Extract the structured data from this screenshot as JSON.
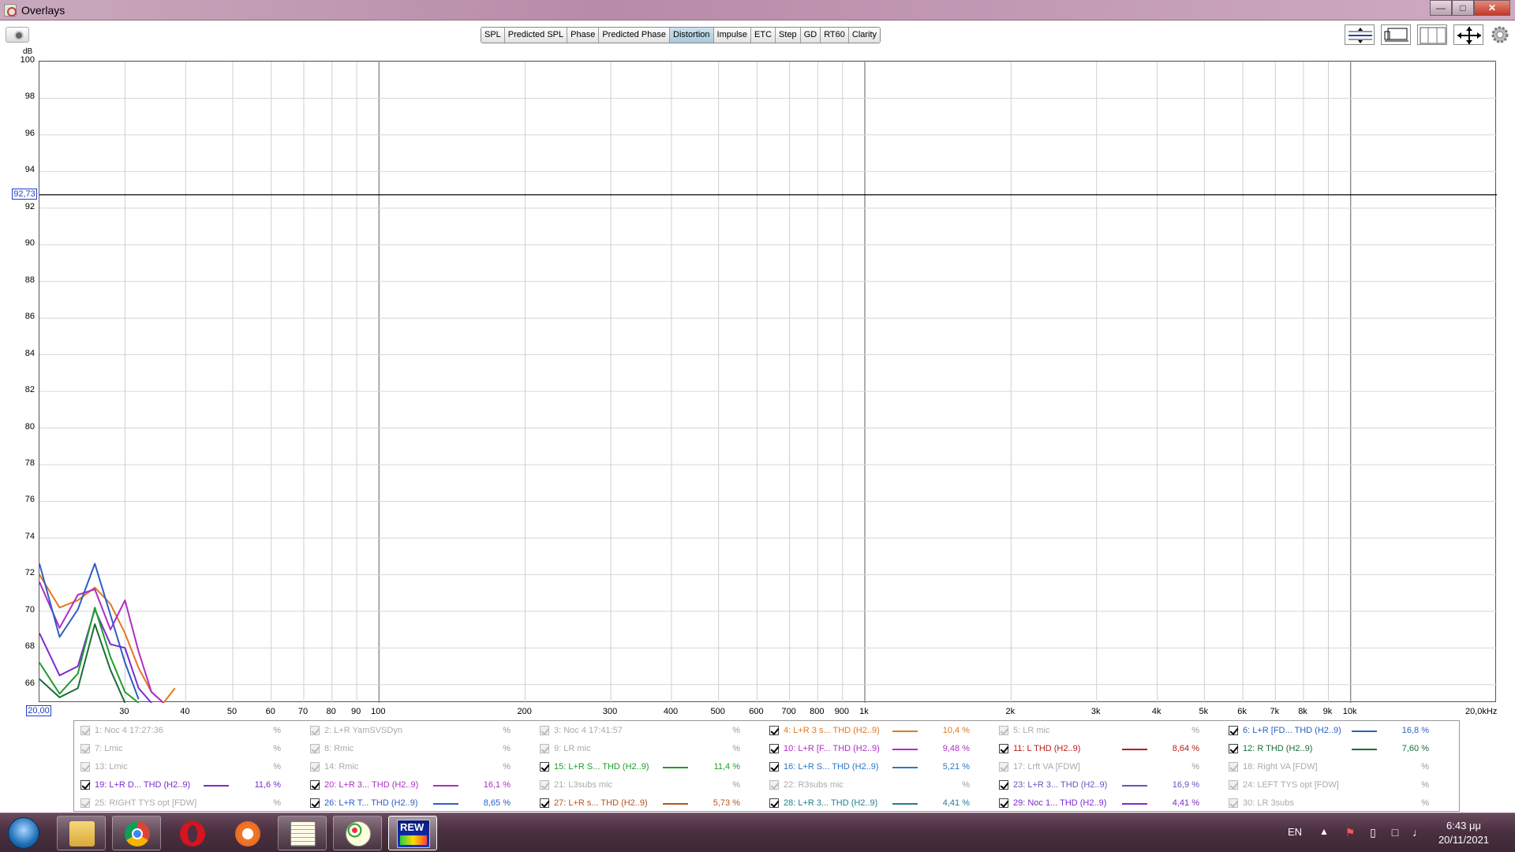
{
  "window": {
    "title": "Overlays"
  },
  "toolbar": {
    "tabs": [
      "SPL",
      "Predicted SPL",
      "Phase",
      "Predicted Phase",
      "Distortion",
      "Impulse",
      "ETC",
      "Step",
      "GD",
      "RT60",
      "Clarity"
    ],
    "active_tab": "Distortion"
  },
  "graph": {
    "y_unit": "dB",
    "y_ticks": [
      "100",
      "98",
      "96",
      "94",
      "92",
      "90",
      "88",
      "86",
      "84",
      "82",
      "80",
      "78",
      "76",
      "74",
      "72",
      "70",
      "68",
      "66"
    ],
    "x_ticks": [
      "30",
      "40",
      "50",
      "60",
      "70",
      "80",
      "90",
      "100",
      "200",
      "300",
      "400",
      "500",
      "600",
      "700",
      "800",
      "900",
      "1k",
      "2k",
      "3k",
      "4k",
      "5k",
      "6k",
      "7k",
      "8k",
      "9k",
      "10k"
    ],
    "x_end_label": "20,0kHz",
    "cursor_y": "92,73",
    "cursor_x": "20,00"
  },
  "chart_data": {
    "type": "line",
    "title": "",
    "xlabel": "",
    "ylabel": "dB",
    "x_scale": "log",
    "xlim": [
      20,
      20000
    ],
    "ylim": [
      65,
      100
    ],
    "grid": true,
    "cursor": {
      "x": 20.0,
      "y": 92.73
    },
    "series": [
      {
        "name": "4: L+R 3 s... THD (H2..9)",
        "color": "#e07a1f",
        "x": [
          20,
          22,
          24,
          26,
          28,
          30,
          32,
          34,
          36,
          38
        ],
        "y": [
          72.0,
          70.2,
          70.6,
          71.3,
          70.4,
          68.8,
          66.9,
          65.6,
          65.0,
          65.8
        ]
      },
      {
        "name": "10: L+R [F... THD (H2..9)",
        "color": "#b02cc7",
        "x": [
          20,
          22,
          24,
          26,
          28,
          30,
          32,
          34,
          36
        ],
        "y": [
          71.6,
          69.1,
          70.9,
          71.2,
          69.0,
          70.6,
          67.8,
          65.6,
          65.0
        ]
      },
      {
        "name": "6: L+R [FD... THD (H2..9)",
        "color": "#2b5fc6",
        "x": [
          20,
          22,
          24,
          26,
          28,
          30,
          32
        ],
        "y": [
          72.6,
          68.6,
          70.1,
          72.6,
          69.8,
          67.2,
          65.2
        ]
      },
      {
        "name": "19: L+R D... THD (H2..9)",
        "color": "#7a2ccf",
        "x": [
          20,
          22,
          24,
          26,
          28,
          30,
          32,
          34
        ],
        "y": [
          68.8,
          66.5,
          67.0,
          70.1,
          68.2,
          68.0,
          65.8,
          65.0
        ]
      },
      {
        "name": "15: L+R S... THD (H2..9)",
        "color": "#1e9e2a",
        "x": [
          20,
          22,
          24,
          26,
          28,
          30,
          32
        ],
        "y": [
          67.2,
          65.5,
          66.6,
          70.2,
          67.5,
          65.6,
          65.0
        ]
      },
      {
        "name": "12: R THD (H2..9)",
        "color": "#1c6b3a",
        "x": [
          20,
          22,
          24,
          26,
          28,
          30
        ],
        "y": [
          66.3,
          65.3,
          65.8,
          69.3,
          66.8,
          65.0
        ]
      }
    ]
  },
  "legend": [
    {
      "num": "1",
      "name": "1: Noc 4 17:27:36",
      "checked": false,
      "color": "",
      "value": "%"
    },
    {
      "num": "2",
      "name": "2: L+R YamSVSDyn",
      "checked": false,
      "color": "",
      "value": "%"
    },
    {
      "num": "3",
      "name": "3: Noc 4 17:41:57",
      "checked": false,
      "color": "",
      "value": "%"
    },
    {
      "num": "4",
      "name": "4: L+R 3 s... THD (H2..9)",
      "checked": true,
      "color": "#e07a1f",
      "value": "10,4 %"
    },
    {
      "num": "5",
      "name": "5: LR mic",
      "checked": false,
      "color": "",
      "value": "%"
    },
    {
      "num": "6",
      "name": "6: L+R [FD... THD (H2..9)",
      "checked": true,
      "color": "#2b5fc6",
      "value": "16,8 %"
    },
    {
      "num": "7",
      "name": "7: Lmic",
      "checked": false,
      "color": "",
      "value": "%"
    },
    {
      "num": "8",
      "name": "8: Rmic",
      "checked": false,
      "color": "",
      "value": "%"
    },
    {
      "num": "9",
      "name": "9: LR mic",
      "checked": false,
      "color": "",
      "value": "%"
    },
    {
      "num": "10",
      "name": "10: L+R [F... THD (H2..9)",
      "checked": true,
      "color": "#b02cc7",
      "value": "9,48 %"
    },
    {
      "num": "11",
      "name": "11: L THD (H2..9)",
      "checked": true,
      "color": "#b51e1e",
      "value": "8,64 %"
    },
    {
      "num": "12",
      "name": "12: R THD (H2..9)",
      "checked": true,
      "color": "#1c6b3a",
      "value": "7,60 %"
    },
    {
      "num": "13",
      "name": "13: Lmic",
      "checked": false,
      "color": "",
      "value": "%"
    },
    {
      "num": "14",
      "name": "14: Rmic",
      "checked": false,
      "color": "",
      "value": "%"
    },
    {
      "num": "15",
      "name": "15: L+R S... THD (H2..9)",
      "checked": true,
      "color": "#1e9e2a",
      "value": "11,4 %"
    },
    {
      "num": "16",
      "name": "16: L+R S... THD (H2..9)",
      "checked": true,
      "color": "#2a78c8",
      "value": "5,21 %"
    },
    {
      "num": "17",
      "name": "17: Lrft VA [FDW]",
      "checked": false,
      "color": "",
      "value": "%"
    },
    {
      "num": "18",
      "name": "18: Right VA [FDW]",
      "checked": false,
      "color": "",
      "value": "%"
    },
    {
      "num": "19",
      "name": "19: L+R D... THD (H2..9)",
      "checked": true,
      "color": "#7a2ccf",
      "value": "11,6 %"
    },
    {
      "num": "20",
      "name": "20: L+R 3... THD (H2..9)",
      "checked": true,
      "color": "#b02cc7",
      "value": "16,1 %"
    },
    {
      "num": "21",
      "name": "21: L3subs mic",
      "checked": false,
      "color": "",
      "value": "%"
    },
    {
      "num": "22",
      "name": "22: R3subs mic",
      "checked": false,
      "color": "",
      "value": "%"
    },
    {
      "num": "23",
      "name": "23: L+R 3... THD (H2..9)",
      "checked": true,
      "color": "#6f4fc6",
      "value": "16,9 %"
    },
    {
      "num": "24",
      "name": "24: LEFT TYS opt [FDW]",
      "checked": false,
      "color": "",
      "value": "%"
    },
    {
      "num": "25",
      "name": "25: RIGHT TYS opt [FDW]",
      "checked": false,
      "color": "",
      "value": "%"
    },
    {
      "num": "26",
      "name": "26: L+R T... THD (H2..9)",
      "checked": true,
      "color": "#2b5fc6",
      "value": "8,65 %"
    },
    {
      "num": "27",
      "name": "27: L+R s... THD (H2..9)",
      "checked": true,
      "color": "#b5531e",
      "value": "5,73 %"
    },
    {
      "num": "28",
      "name": "28: L+R 3... THD (H2..9)",
      "checked": true,
      "color": "#1f7f8c",
      "value": "4,41 %"
    },
    {
      "num": "29",
      "name": "29: Noc 1... THD (H2..9)",
      "checked": true,
      "color": "#7a2ccf",
      "value": "4,41 %"
    },
    {
      "num": "30",
      "name": "30: LR 3subs",
      "checked": false,
      "color": "",
      "value": "%"
    }
  ],
  "taskbar": {
    "apps": [
      "file-explorer",
      "chrome",
      "opera",
      "brave",
      "notepad",
      "paint",
      "rew"
    ],
    "rew_label": "REW",
    "language": "EN",
    "time": "6:43 μμ",
    "date": "20/11/2021"
  }
}
